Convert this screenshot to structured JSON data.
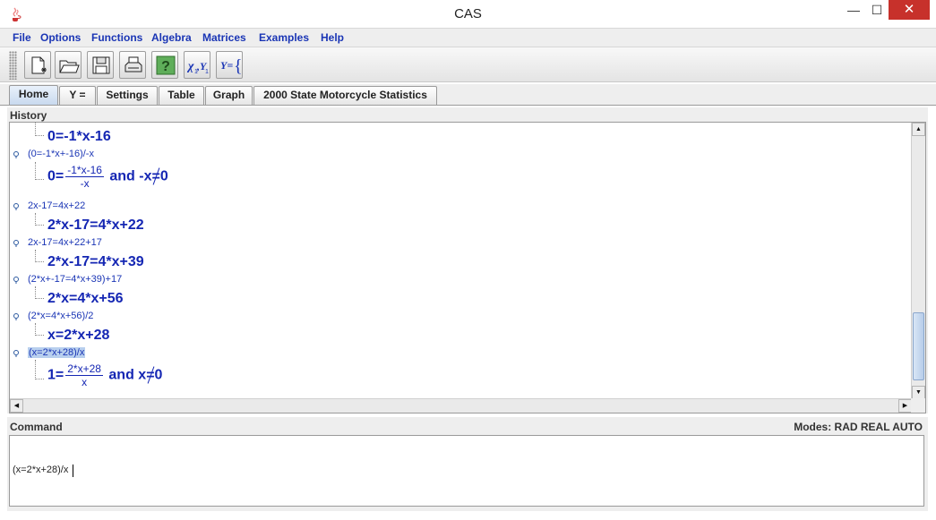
{
  "window": {
    "title": "CAS",
    "minimize": "—",
    "maximize": "☐",
    "close": "✕"
  },
  "menu": [
    "File",
    "Options",
    "Functions",
    "Algebra",
    "Matrices",
    "Examples",
    "Help"
  ],
  "toolbar": [
    "new-document-icon",
    "open-folder-icon",
    "save-disk-icon",
    "print-icon",
    "help-icon",
    "xy-points-icon",
    "y-equals-icon"
  ],
  "tabs": [
    "Home",
    "Y =",
    "Settings",
    "Table",
    "Graph",
    "2000 State Motorcycle Statistics"
  ],
  "history": {
    "label": "History",
    "entries": [
      {
        "result": "0=-1*x-16"
      },
      {
        "command": "(0=-1*x+-16)/-x",
        "lhs": "0=",
        "num": "-1*x-16",
        "den": "-x",
        "tail": " and -x",
        "zero": "0"
      },
      {
        "command": "2x-17=4x+22",
        "result": "2*x-17=4*x+22"
      },
      {
        "command": "2x-17=4x+22+17",
        "result": "2*x-17=4*x+39"
      },
      {
        "command": "(2*x+-17=4*x+39)+17",
        "result": "2*x=4*x+56"
      },
      {
        "command": "(2*x=4*x+56)/2",
        "result": "x=2*x+28"
      },
      {
        "command": "(x=2*x+28)/x",
        "lhs": "1=",
        "num": "2*x+28",
        "den": "x",
        "tail": " and x",
        "zero": "0"
      }
    ]
  },
  "command": {
    "label": "Command",
    "modes": "Modes: RAD REAL AUTO",
    "value": "(x=2*x+28)/x"
  },
  "colors": {
    "menu_text": "#1a35b5",
    "result_text": "#1426b3",
    "selection": "#b8cfee",
    "close_button": "#c7312b"
  }
}
